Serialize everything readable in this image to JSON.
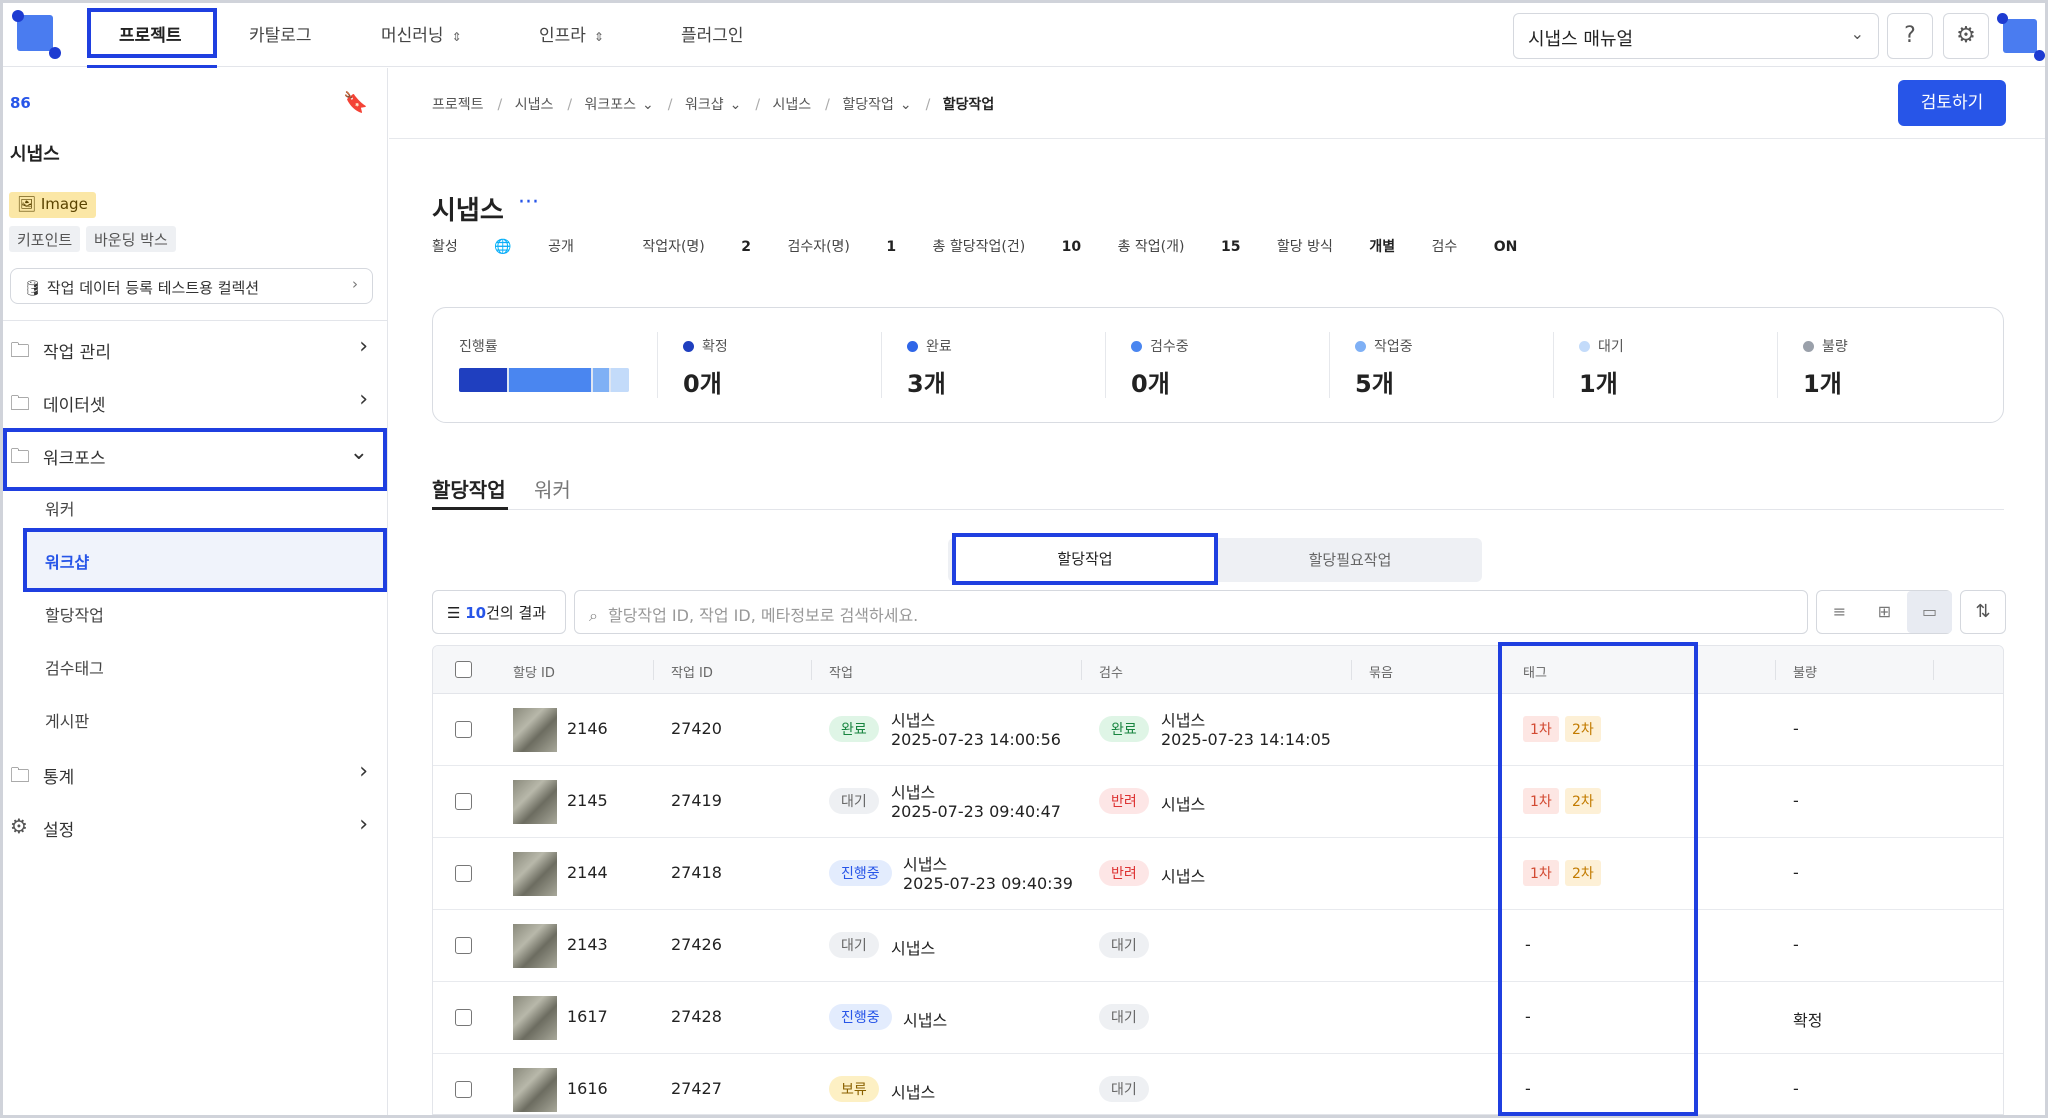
{
  "nav": {
    "items": [
      "프로젝트",
      "카탈로그",
      "머신러닝",
      "인프라",
      "플러그인"
    ],
    "manual_label": "시냅스 매뉴얼"
  },
  "sidebar": {
    "id": "86",
    "title": "시냅스",
    "data_type": "Image",
    "chips": [
      "키포인트",
      "바운딩 박스"
    ],
    "collection": "작업 데이터 등록 테스트용 컬렉션",
    "menus": {
      "work_manage": "작업 관리",
      "dataset": "데이터셋",
      "workforce": "워크포스",
      "stats": "통계",
      "settings": "설정"
    },
    "subs": [
      "워커",
      "워크샵",
      "할당작업",
      "검수태그",
      "게시판"
    ]
  },
  "breadcrumb": [
    "프로젝트",
    "시냅스",
    "워크포스",
    "워크샵",
    "시냅스",
    "할당작업",
    "할당작업"
  ],
  "review_button": "검토하기",
  "page": {
    "title": "시냅스",
    "more": "···",
    "meta": {
      "status": "활성",
      "visibility": "공개",
      "workers_label": "작업자(명)",
      "workers": "2",
      "reviewers_label": "검수자(명)",
      "reviewers": "1",
      "total_assign_label": "총 할당작업(건)",
      "total_assign": "10",
      "total_tasks_label": "총 작업(개)",
      "total_tasks": "15",
      "assign_mode_label": "할당 방식",
      "assign_mode": "개별",
      "review_label": "검수",
      "review": "ON"
    }
  },
  "stats": {
    "progress_label": "진행률",
    "items": [
      {
        "label": "확정",
        "value": "0개",
        "color": "#1f3fbf"
      },
      {
        "label": "완료",
        "value": "3개",
        "color": "#2f66e8"
      },
      {
        "label": "검수중",
        "value": "0개",
        "color": "#4a86f0"
      },
      {
        "label": "작업중",
        "value": "5개",
        "color": "#7fb0f5"
      },
      {
        "label": "대기",
        "value": "1개",
        "color": "#c3dbfa"
      },
      {
        "label": "불량",
        "value": "1개",
        "color": "#9aa0aa"
      }
    ]
  },
  "tabs": [
    "할당작업",
    "워커"
  ],
  "segment": [
    "할당작업",
    "할당필요작업"
  ],
  "filter": {
    "count": "10",
    "suffix": "건의 결과"
  },
  "search_placeholder": "할당작업 ID, 작업 ID, 메타정보로 검색하세요.",
  "columns": [
    "할당 ID",
    "작업 ID",
    "작업",
    "검수",
    "묶음",
    "태그",
    "불량"
  ],
  "rows": [
    {
      "aid": "2146",
      "tid": "27420",
      "work_status": "완료",
      "worker": "시냅스",
      "work_time": "2025-07-23 14:00:56",
      "review_status": "완료",
      "reviewer": "시냅스",
      "review_time": "2025-07-23 14:14:05",
      "tag1": "1차",
      "tag2": "2차",
      "tag_dash": "",
      "defect": "-"
    },
    {
      "aid": "2145",
      "tid": "27419",
      "work_status": "대기",
      "worker": "시냅스",
      "work_time": "2025-07-23 09:40:47",
      "review_status": "반려",
      "reviewer": "시냅스",
      "review_time": "",
      "tag1": "1차",
      "tag2": "2차",
      "tag_dash": "",
      "defect": "-"
    },
    {
      "aid": "2144",
      "tid": "27418",
      "work_status": "진행중",
      "worker": "시냅스",
      "work_time": "2025-07-23 09:40:39",
      "review_status": "반려",
      "reviewer": "시냅스",
      "review_time": "",
      "tag1": "1차",
      "tag2": "2차",
      "tag_dash": "",
      "defect": "-"
    },
    {
      "aid": "2143",
      "tid": "27426",
      "work_status": "대기",
      "worker": "시냅스",
      "work_time": "",
      "review_status": "대기",
      "reviewer": "",
      "review_time": "",
      "tag1": "",
      "tag2": "",
      "tag_dash": "-",
      "defect": "-"
    },
    {
      "aid": "1617",
      "tid": "27428",
      "work_status": "진행중",
      "worker": "시냅스",
      "work_time": "",
      "review_status": "대기",
      "reviewer": "",
      "review_time": "",
      "tag1": "",
      "tag2": "",
      "tag_dash": "-",
      "defect": "확정"
    },
    {
      "aid": "1616",
      "tid": "27427",
      "work_status": "보류",
      "worker": "시냅스",
      "work_time": "",
      "review_status": "대기",
      "reviewer": "",
      "review_time": "",
      "tag1": "",
      "tag2": "",
      "tag_dash": "-",
      "defect": "-"
    }
  ]
}
